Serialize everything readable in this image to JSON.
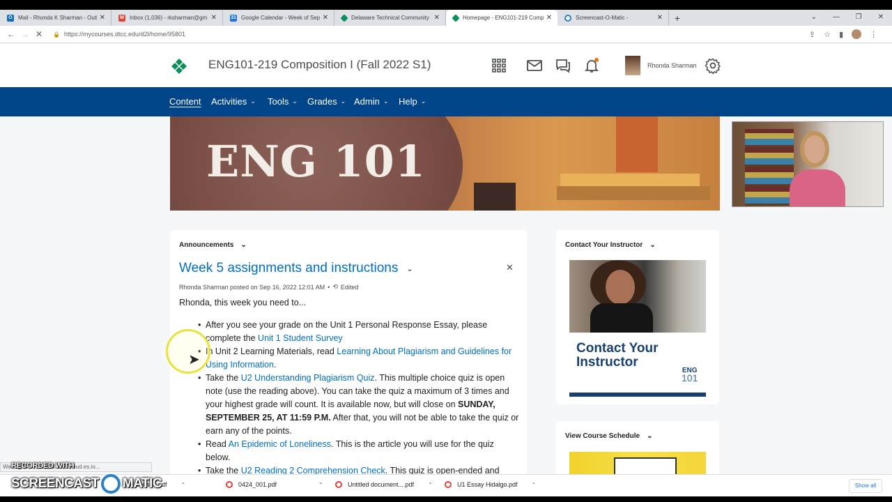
{
  "browser": {
    "tabs": [
      {
        "title": "Mail - Rhonda K Sharman - Outl",
        "icon": "outlook-icon",
        "color": "#0f6cbd"
      },
      {
        "title": "Inbox (1,036) - rksharman@gm",
        "icon": "gmail-icon",
        "color": "#db4437"
      },
      {
        "title": "Google Calendar - Week of Sept",
        "icon": "calendar-icon",
        "color": "#1a73e8"
      },
      {
        "title": "Delaware Technical Community",
        "icon": "d2l-icon",
        "color": "#0a8f5a"
      },
      {
        "title": "Homepage - ENG101-219 Comp",
        "icon": "d2l-icon",
        "color": "#0a8f5a"
      },
      {
        "title": "Screencast-O-Matic -",
        "icon": "screencast-icon",
        "color": "#2c7fc4"
      }
    ],
    "new_tab": "+",
    "url": "https://mycourses.dtcc.edu/d2l/home/95801"
  },
  "header": {
    "course_title": "ENG101-219 Composition I (Fall 2022 S1)",
    "user_name": "Rhonda Sharman"
  },
  "nav": {
    "items": [
      {
        "label": "Content"
      },
      {
        "label": "Activities"
      },
      {
        "label": "Tools"
      },
      {
        "label": "Grades"
      },
      {
        "label": "Admin"
      },
      {
        "label": "Help"
      }
    ]
  },
  "banner": {
    "text": "ENG 101"
  },
  "announcements": {
    "widget_title": "Announcements",
    "title": "Week 5 assignments and instructions",
    "meta": "Rhonda Sharman posted on Sep 16, 2022 12:01 AM",
    "edited": "Edited",
    "greeting": "Rhonda, this week you need to...",
    "items": [
      {
        "t1": "After you see your grade on the Unit 1 Personal Response Essay, please complete the ",
        "link": "Unit 1 Student Survey"
      },
      {
        "t1": "In Unit 2 Learning Materials, read ",
        "link": "Learning About Plagiarism and Guidelines for Using Information",
        "t2": "."
      },
      {
        "t1": "Take the ",
        "link": "U2 Understanding Plagiarism Quiz",
        "t2": ". This multiple choice quiz is open note (use the reading above). You can take the quiz a maximum of 3 times and your highest grade will count. It is available now, but will close on ",
        "bold": "SUNDAY, SEPTEMBER 25, AT 11:59 P.M.",
        "t3": " After that, you will not be able to take the quiz or earn any of the points."
      },
      {
        "t1": "Read ",
        "link": "An Epidemic of Loneliness",
        "t2": ". This is the article you will use for the quiz below."
      },
      {
        "t1": "Take the ",
        "link": "U2 Reading 2 Comprehension Check",
        "t2": ". This quiz is open-ended and"
      }
    ]
  },
  "contact": {
    "widget_title": "Contact Your Instructor",
    "image_text": "Contact Your Instructor",
    "image_eng": "ENG",
    "image_num": "101"
  },
  "schedule": {
    "widget_title": "View Course Schedule"
  },
  "status_text": "Waiting for ...s-east-1.aws.cloud.es.io...",
  "watermark": {
    "line1": "RECORDED WITH",
    "line2a": "SCREENCAST",
    "line2b": "MATIC"
  },
  "downloads": {
    "items": [
      "...venson.pdf",
      "0424_001.pdf",
      "Untitled document....pdf",
      "U1 Essay Hidalgo.pdf"
    ],
    "show_all": "Show all"
  },
  "colors": {
    "nav": "#004489",
    "link": "#006fbf",
    "brand": "#0a8f5a"
  }
}
